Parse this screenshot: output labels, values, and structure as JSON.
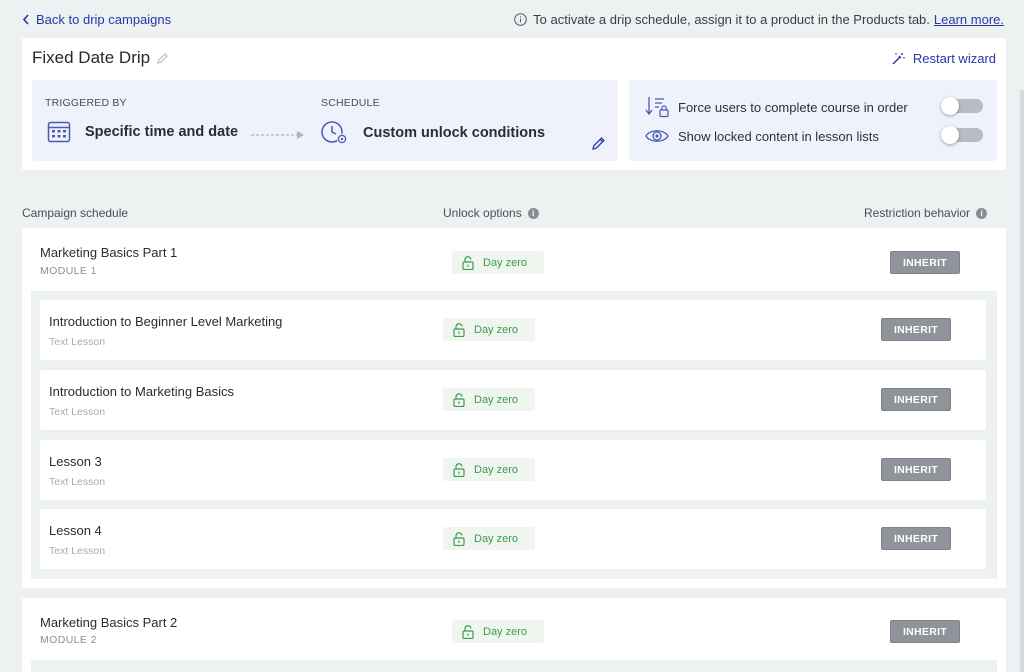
{
  "topbar": {
    "back_label": "Back to drip campaigns",
    "notice_text": "To activate a drip schedule, assign it to a product in the Products tab.",
    "learn_more": "Learn more."
  },
  "header": {
    "title": "Fixed Date Drip",
    "restart_label": "Restart wizard",
    "triggered_by_label": "TRIGGERED BY",
    "triggered_by_value": "Specific time and date",
    "schedule_label": "SCHEDULE",
    "schedule_value": "Custom unlock conditions",
    "settings": [
      {
        "label": "Force users to complete course in order",
        "enabled": false
      },
      {
        "label": "Show locked content in lesson lists",
        "enabled": false
      }
    ]
  },
  "columns": {
    "schedule": "Campaign schedule",
    "unlock": "Unlock options",
    "restriction": "Restriction behavior"
  },
  "modules": [
    {
      "name": "Marketing Basics Part 1",
      "sub": "MODULE 1",
      "unlock": "Day zero",
      "restriction": "INHERIT",
      "lessons": [
        {
          "name": "Introduction to Beginner Level Marketing",
          "type": "Text Lesson",
          "unlock": "Day zero",
          "restriction": "INHERIT"
        },
        {
          "name": "Introduction to Marketing Basics",
          "type": "Text Lesson",
          "unlock": "Day zero",
          "restriction": "INHERIT"
        },
        {
          "name": "Lesson 3",
          "type": "Text Lesson",
          "unlock": "Day zero",
          "restriction": "INHERIT"
        },
        {
          "name": "Lesson 4",
          "type": "Text Lesson",
          "unlock": "Day zero",
          "restriction": "INHERIT"
        }
      ]
    },
    {
      "name": "Marketing Basics Part 2",
      "sub": "MODULE 2",
      "unlock": "Day zero",
      "restriction": "INHERIT",
      "lessons": []
    }
  ],
  "colors": {
    "accent": "#2438a8",
    "unlock_green": "#3d9a4f",
    "unlock_bg": "#eef6ef",
    "inherit_bg": "#8f939a",
    "panel_bg": "#eff1fb"
  }
}
